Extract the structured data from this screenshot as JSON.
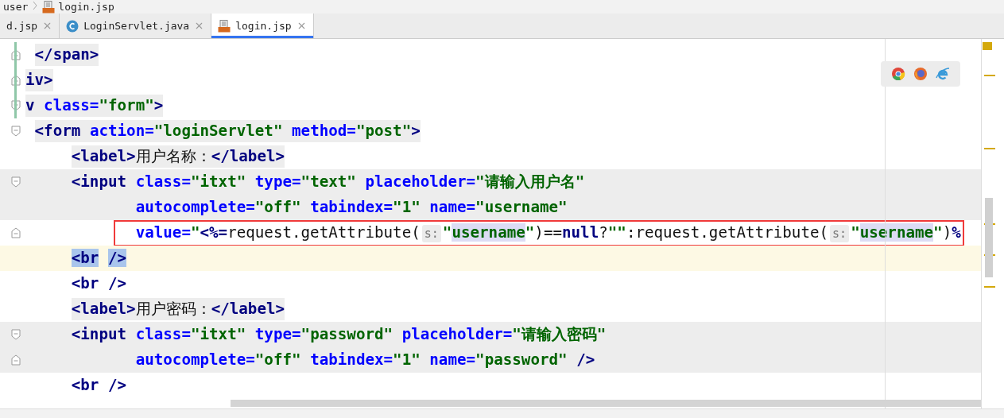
{
  "breadcrumb": [
    "user",
    "login.jsp"
  ],
  "tabs": [
    {
      "label": "d.jsp",
      "selected": false
    },
    {
      "label": "LoginServlet.java",
      "kind": "class",
      "selected": false
    },
    {
      "label": "login.jsp",
      "kind": "jsp",
      "selected": true
    }
  ],
  "lines": [
    {
      "kind": "tag",
      "fold_open": false,
      "fold_close": true,
      "boxed": false,
      "tokens": [
        {
          "kind": "tag",
          "text": " </span>"
        }
      ]
    },
    {
      "kind": "tag",
      "fold_open": false,
      "fold_close": true,
      "boxed": false,
      "tokens": [
        {
          "kind": "tag",
          "text": "iv>"
        }
      ]
    },
    {
      "kind": "tag",
      "fold_open": true,
      "fold_close": false,
      "boxed": false,
      "tokens": [
        {
          "kind": "tag",
          "text": "v"
        },
        {
          "kind": "attr",
          "text": " class="
        },
        {
          "kind": "str",
          "text": "\"form\""
        },
        {
          "kind": "tag",
          "text": ">"
        }
      ]
    },
    {
      "kind": "tag",
      "fold_open": true,
      "fold_close": false,
      "boxed": false,
      "tokens": [
        {
          "kind": "tag",
          "text": " <form"
        },
        {
          "kind": "attr",
          "text": " action="
        },
        {
          "kind": "str",
          "text": "\"loginServlet\""
        },
        {
          "kind": "attr",
          "text": " method="
        },
        {
          "kind": "str",
          "text": "\"post\""
        },
        {
          "kind": "tag",
          "text": ">"
        }
      ]
    },
    {
      "kind": "tag",
      "fold_open": false,
      "fold_close": false,
      "boxed": false,
      "tokens": [
        {
          "kind": "tag",
          "text": "     <label>"
        },
        {
          "kind": "plain",
          "text": "用户名称："
        },
        {
          "kind": "tag",
          "text": "</label>"
        }
      ]
    },
    {
      "kind": "block",
      "fold_open": true,
      "fold_close": false,
      "boxed": false,
      "tokens": [
        {
          "kind": "tag",
          "text": "     <input"
        },
        {
          "kind": "attr",
          "text": " class="
        },
        {
          "kind": "str",
          "text": "\"itxt\""
        },
        {
          "kind": "attr",
          "text": " type="
        },
        {
          "kind": "str",
          "text": "\"text\""
        },
        {
          "kind": "attr",
          "text": " placeholder="
        },
        {
          "kind": "str",
          "text": "\"请输入用户名\""
        }
      ]
    },
    {
      "kind": "block",
      "fold_open": false,
      "fold_close": false,
      "boxed": false,
      "tokens": [
        {
          "kind": "attr",
          "text": "            autocomplete="
        },
        {
          "kind": "str",
          "text": "\"off\""
        },
        {
          "kind": "attr",
          "text": " tabindex="
        },
        {
          "kind": "str",
          "text": "\"1\""
        },
        {
          "kind": "attr",
          "text": " name="
        },
        {
          "kind": "str",
          "text": "\"username\""
        }
      ]
    },
    {
      "kind": "plain",
      "fold_open": false,
      "fold_close": true,
      "boxed": true,
      "tokens": [
        {
          "kind": "attr",
          "text": "            value="
        },
        {
          "kind": "str",
          "text": "\""
        },
        {
          "kind": "tag",
          "text": "<%="
        },
        {
          "kind": "plain",
          "text": "request.getAttribute("
        },
        {
          "kind": "hint",
          "text": "s:"
        },
        {
          "kind": "str",
          "text": "\""
        },
        {
          "kind": "marked",
          "text": "username"
        },
        {
          "kind": "str",
          "text": "\""
        },
        {
          "kind": "plain",
          "text": ")=="
        },
        {
          "kind": "keyword",
          "text": "null"
        },
        {
          "kind": "plain",
          "text": "?"
        },
        {
          "kind": "str",
          "text": "\"\""
        },
        {
          "kind": "plain",
          "text": ":request.getAttribute("
        },
        {
          "kind": "hint",
          "text": "s:"
        },
        {
          "kind": "str",
          "text": "\""
        },
        {
          "kind": "marked",
          "text": "username"
        },
        {
          "kind": "str",
          "text": "\""
        },
        {
          "kind": "plain",
          "text": ")"
        },
        {
          "kind": "tag",
          "text": "%"
        }
      ]
    },
    {
      "kind": "current",
      "fold_open": false,
      "fold_close": false,
      "boxed": false,
      "tokens": [
        {
          "kind": "matched",
          "text": "     <br"
        },
        {
          "kind": "matched",
          "text": " />"
        }
      ]
    },
    {
      "kind": "plain",
      "fold_open": false,
      "fold_close": false,
      "boxed": false,
      "tokens": [
        {
          "kind": "tag",
          "text": "     <br />"
        }
      ]
    },
    {
      "kind": "tag",
      "fold_open": false,
      "fold_close": false,
      "boxed": false,
      "tokens": [
        {
          "kind": "tag",
          "text": "     <label>"
        },
        {
          "kind": "plain",
          "text": "用户密码："
        },
        {
          "kind": "tag",
          "text": "</label>"
        }
      ]
    },
    {
      "kind": "block",
      "fold_open": true,
      "fold_close": false,
      "boxed": false,
      "tokens": [
        {
          "kind": "tag",
          "text": "     <input"
        },
        {
          "kind": "attr",
          "text": " class="
        },
        {
          "kind": "str",
          "text": "\"itxt\""
        },
        {
          "kind": "attr",
          "text": " type="
        },
        {
          "kind": "str",
          "text": "\"password\""
        },
        {
          "kind": "attr",
          "text": " placeholder="
        },
        {
          "kind": "str",
          "text": "\"请输入密码\""
        }
      ]
    },
    {
      "kind": "block",
      "fold_open": false,
      "fold_close": true,
      "boxed": false,
      "tokens": [
        {
          "kind": "attr",
          "text": "            autocomplete="
        },
        {
          "kind": "str",
          "text": "\"off\""
        },
        {
          "kind": "attr",
          "text": " tabindex="
        },
        {
          "kind": "str",
          "text": "\"1\""
        },
        {
          "kind": "attr",
          "text": " name="
        },
        {
          "kind": "str",
          "text": "\"password\""
        },
        {
          "kind": "tag",
          "text": " />"
        }
      ]
    },
    {
      "kind": "plain",
      "fold_open": false,
      "fold_close": false,
      "boxed": false,
      "tokens": [
        {
          "kind": "tag",
          "text": "     <br />"
        }
      ]
    }
  ]
}
